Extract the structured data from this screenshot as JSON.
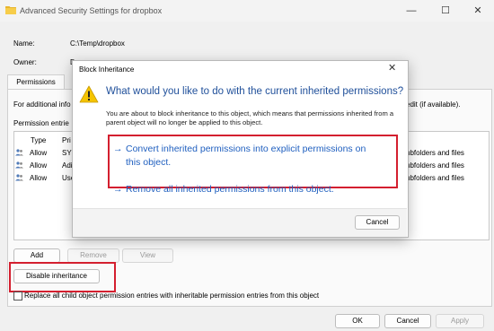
{
  "window": {
    "title": "Advanced Security Settings for dropbox",
    "minimize_glyph": "—",
    "maximize_glyph": "☐",
    "close_glyph": "✕",
    "icon": "folder-icon"
  },
  "info": {
    "name_label": "Name:",
    "name_value": "C:\\Temp\\dropbox",
    "owner_label": "Owner:",
    "owner_value": "D",
    "owner_suffix": "Ch"
  },
  "tabs": [
    {
      "label": "Permissions"
    }
  ],
  "permissions": {
    "info_text": "For additional info",
    "info_text_right": "edit (if available).",
    "entries_label": "Permission entrie",
    "columns": {
      "type": "Type",
      "principal": "Pri"
    },
    "rows": [
      {
        "type": "Allow",
        "principal": "SYS",
        "applies": "ubfolders and files"
      },
      {
        "type": "Allow",
        "principal": "Adi",
        "applies": "ubfolders and files"
      },
      {
        "type": "Allow",
        "principal": "Use",
        "applies": "ubfolders and files"
      }
    ],
    "add_label": "Add",
    "remove_label": "Remove",
    "view_label": "View",
    "disable_inheritance_label": "Disable inheritance",
    "replace_label": "Replace all child object permission entries with inheritable permission entries from this object"
  },
  "footer": {
    "ok_label": "OK",
    "cancel_label": "Cancel",
    "apply_label": "Apply"
  },
  "dialog": {
    "title": "Block Inheritance",
    "close_glyph": "✕",
    "question": "What would you like to do with the current inherited permissions?",
    "description": "You are about to block inheritance to this object, which means that permissions inherited from a parent object will no longer be applied to this object.",
    "arrow": "→",
    "option1_line1": "Convert inherited permissions into explicit permissions on",
    "option1_line2": "this object.",
    "option2": "Remove all inherited permissions from this object.",
    "cancel_label": "Cancel"
  },
  "colors": {
    "highlight": "#d41f2f",
    "link_blue": "#1f5fbf",
    "warning_yellow": "#f5c400"
  }
}
